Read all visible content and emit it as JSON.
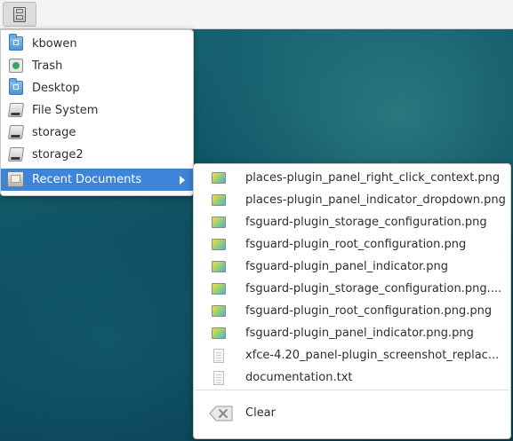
{
  "places_menu": {
    "items": [
      {
        "label": "kbowen",
        "icon": "home-folder-icon"
      },
      {
        "label": "Trash",
        "icon": "trash-icon"
      },
      {
        "label": "Desktop",
        "icon": "desktop-folder-icon"
      },
      {
        "label": "File System",
        "icon": "drive-icon"
      },
      {
        "label": "storage",
        "icon": "drive-icon"
      },
      {
        "label": "storage2",
        "icon": "drive-icon"
      },
      {
        "label": "Recent Documents",
        "icon": "recent-documents-icon"
      }
    ],
    "active_item": "Recent Documents"
  },
  "recent_documents": {
    "files": [
      {
        "label": "places-plugin_panel_right_click_context.png",
        "icon": "image-file-icon"
      },
      {
        "label": "places-plugin_panel_indicator_dropdown.png",
        "icon": "image-file-icon"
      },
      {
        "label": "fsguard-plugin_storage_configuration.png",
        "icon": "image-file-icon"
      },
      {
        "label": "fsguard-plugin_root_configuration.png",
        "icon": "image-file-icon"
      },
      {
        "label": "fsguard-plugin_panel_indicator.png",
        "icon": "image-file-icon"
      },
      {
        "label": "fsguard-plugin_storage_configuration.png....",
        "icon": "image-file-icon"
      },
      {
        "label": "fsguard-plugin_root_configuration.png.png",
        "icon": "image-file-icon"
      },
      {
        "label": "fsguard-plugin_panel_indicator.png.png",
        "icon": "image-file-icon"
      },
      {
        "label": "xfce-4.20_panel-plugin_screenshot_replac...",
        "icon": "text-file-icon"
      },
      {
        "label": "documentation.txt",
        "icon": "text-file-icon"
      }
    ],
    "clear_label": "Clear"
  },
  "colors": {
    "highlight": "#3d85d8",
    "menu_background": "#ffffff",
    "panel_background": "#f4f4f4"
  }
}
